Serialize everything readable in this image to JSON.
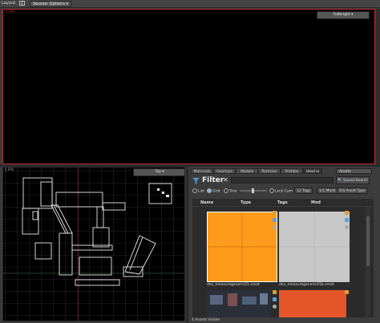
{
  "topbar": {
    "layout_label": "Layout:",
    "session_options": "Session Options"
  },
  "viewport_top": {
    "fps": "5 FPS",
    "mode": "Fullbright"
  },
  "viewport_bottom_left": {
    "fps": "5 FPS",
    "mode": "Top"
  },
  "browser": {
    "tabs": [
      "Materials",
      "Overlays",
      "Models",
      "Particles",
      "Prefabs",
      "Used in"
    ],
    "active_tab": "Used in",
    "asset_type_dropdown": "Assets",
    "filter": {
      "title": "Filter",
      "close": "✕",
      "saved_search": "Saved Search"
    },
    "view_modes": [
      "List",
      "Grid",
      "Tree"
    ],
    "selected_view": "Grid",
    "lock_cam": "Lock Cam",
    "tags_chip": "12 Tags",
    "mods_chip": "1/1 Mods",
    "asset_type_chip": "4/4 Asset Type",
    "columns": [
      "Name",
      "Type",
      "Tags",
      "Mod"
    ],
    "assets": [
      {
        "name": "dev_measuregeneric01.vmat",
        "color": "#ff9b1a"
      },
      {
        "name": "dev_measuregeneric01b.vmat",
        "color": "#c8c8c8"
      },
      {
        "name": "",
        "color": "#2a2f3a"
      },
      {
        "name": "",
        "color": "#e4552a"
      }
    ],
    "status": "4 Assets Visible"
  },
  "colors": {
    "accent_red": "#c0282d",
    "orange": "#ff9b1a"
  }
}
